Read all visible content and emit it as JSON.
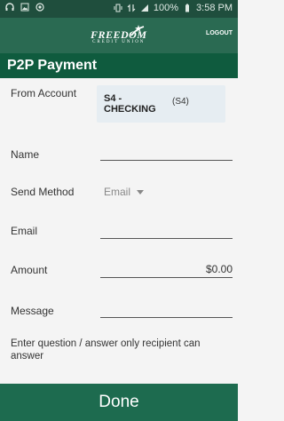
{
  "status_bar": {
    "battery": "100%",
    "time": "3:58 PM",
    "left_icons": [
      "headset-icon",
      "gallery-icon",
      "chrome-icon"
    ],
    "right_icons": [
      "vibrate-icon",
      "network-icon",
      "signal-icon",
      "battery-icon"
    ]
  },
  "header": {
    "logo_text": "FREEDOM",
    "logo_subtext": "CREDIT UNION",
    "logout_label": "LOGOUT"
  },
  "page": {
    "title": "P2P Payment"
  },
  "form": {
    "from_account_label": "From Account",
    "account_name": "S4 - CHECKING",
    "account_code": "(S4)",
    "name_label": "Name",
    "send_method_label": "Send Method",
    "send_method_value": "Email",
    "email_label": "Email",
    "amount_label": "Amount",
    "amount_value": "$0.00",
    "message_label": "Message",
    "question_note": "Enter question / answer only recipient can answer"
  },
  "footer": {
    "done_label": "Done"
  },
  "colors": {
    "header_green": "#2a6a52",
    "title_green": "#0f5b3e",
    "done_green": "#1d6b4f"
  }
}
